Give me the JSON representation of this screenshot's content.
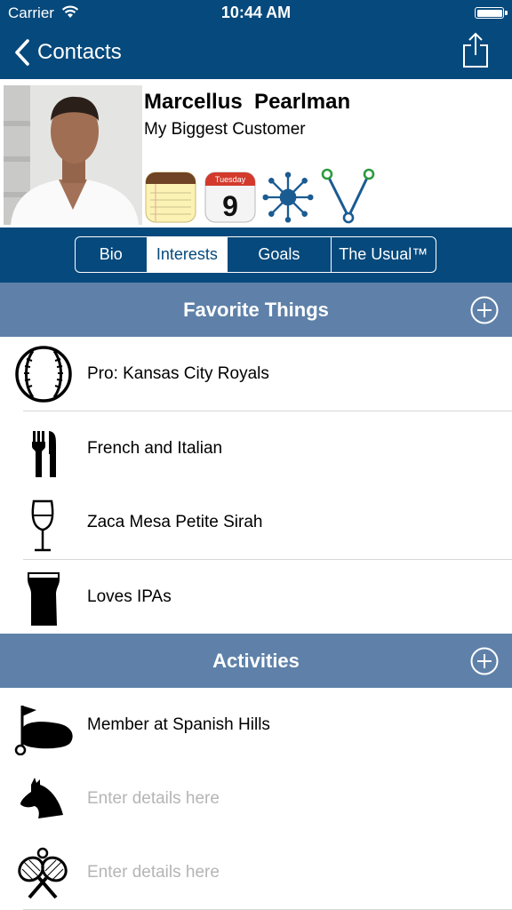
{
  "status_bar": {
    "carrier": "Carrier",
    "time": "10:44 AM"
  },
  "nav": {
    "back_label": "Contacts",
    "share_icon": "share-icon"
  },
  "contact": {
    "name": "Marcellus  Pearlman",
    "subtitle": "My Biggest Customer",
    "calendar": {
      "day_name": "Tuesday",
      "day_number": "9"
    },
    "tools": [
      "notes-icon",
      "calendar-icon",
      "network-icon",
      "connections-icon"
    ]
  },
  "tabs": [
    {
      "label": "Bio",
      "active": false
    },
    {
      "label": "Interests",
      "active": true
    },
    {
      "label": "Goals",
      "active": false
    },
    {
      "label": "The Usual™",
      "active": false
    }
  ],
  "sections": [
    {
      "title": "Favorite Things",
      "items": [
        {
          "icon": "baseball-icon",
          "text": "Pro: Kansas City Royals",
          "placeholder": false
        },
        {
          "icon": "fork-knife-icon",
          "text": "French and Italian",
          "placeholder": false
        },
        {
          "icon": "wine-glass-icon",
          "text": "Zaca Mesa Petite Sirah",
          "placeholder": false
        },
        {
          "icon": "beer-glass-icon",
          "text": "Loves IPAs",
          "placeholder": false
        }
      ]
    },
    {
      "title": "Activities",
      "items": [
        {
          "icon": "golf-icon",
          "text": "Member at Spanish Hills",
          "placeholder": false
        },
        {
          "icon": "horse-icon",
          "text": "Enter details here",
          "placeholder": true
        },
        {
          "icon": "tennis-icon",
          "text": "Enter details here",
          "placeholder": true
        }
      ]
    }
  ],
  "colors": {
    "nav_blue": "#06497c",
    "section_blue": "#5f81a9",
    "placeholder_gray": "#b5b5b5"
  }
}
